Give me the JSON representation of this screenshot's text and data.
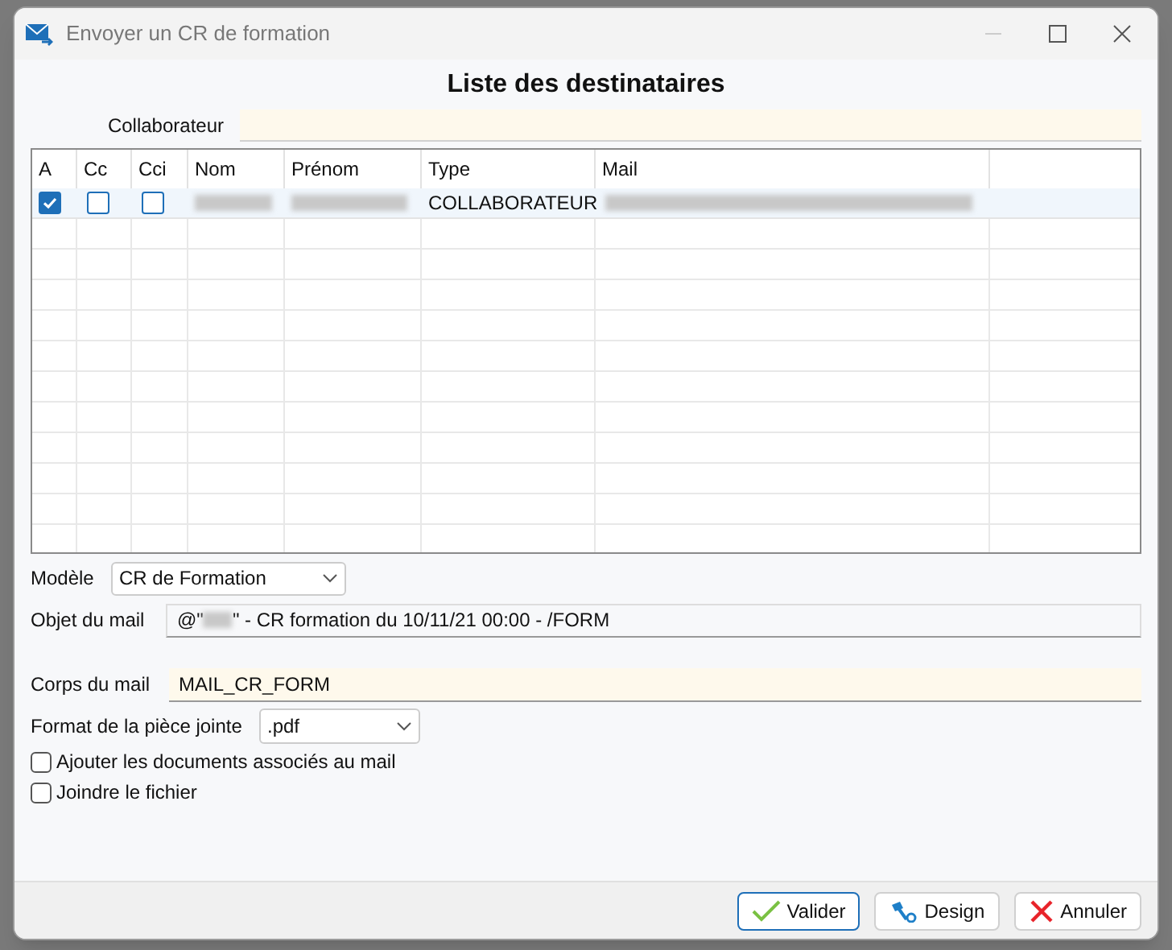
{
  "window": {
    "title": "Envoyer un CR de formation"
  },
  "heading": "Liste des destinataires",
  "collaborateur": {
    "label": "Collaborateur"
  },
  "table": {
    "columns": [
      "A",
      "Cc",
      "Cci",
      "Nom",
      "Prénom",
      "Type",
      "Mail"
    ],
    "rows": [
      {
        "a": true,
        "cc": false,
        "cci": false,
        "type": "COLLABORATEUR"
      }
    ]
  },
  "modele": {
    "label": "Modèle",
    "value": "CR de Formation"
  },
  "objet": {
    "label": "Objet du mail",
    "prefix": "@\"",
    "suffix": "\" - CR formation du 10/11/21 00:00 - /FORM"
  },
  "corps": {
    "label": "Corps du mail",
    "value": "MAIL_CR_FORM"
  },
  "format": {
    "label": "Format de la pièce jointe",
    "value": ".pdf"
  },
  "options": [
    {
      "label": "Ajouter les documents associés au mail",
      "checked": false
    },
    {
      "label": "Joindre le fichier",
      "checked": false
    }
  ],
  "buttons": [
    {
      "kind": "validate",
      "label": "Valider",
      "focused": true
    },
    {
      "kind": "design",
      "label": "Design",
      "focused": false
    },
    {
      "kind": "cancel",
      "label": "Annuler",
      "focused": false
    }
  ]
}
